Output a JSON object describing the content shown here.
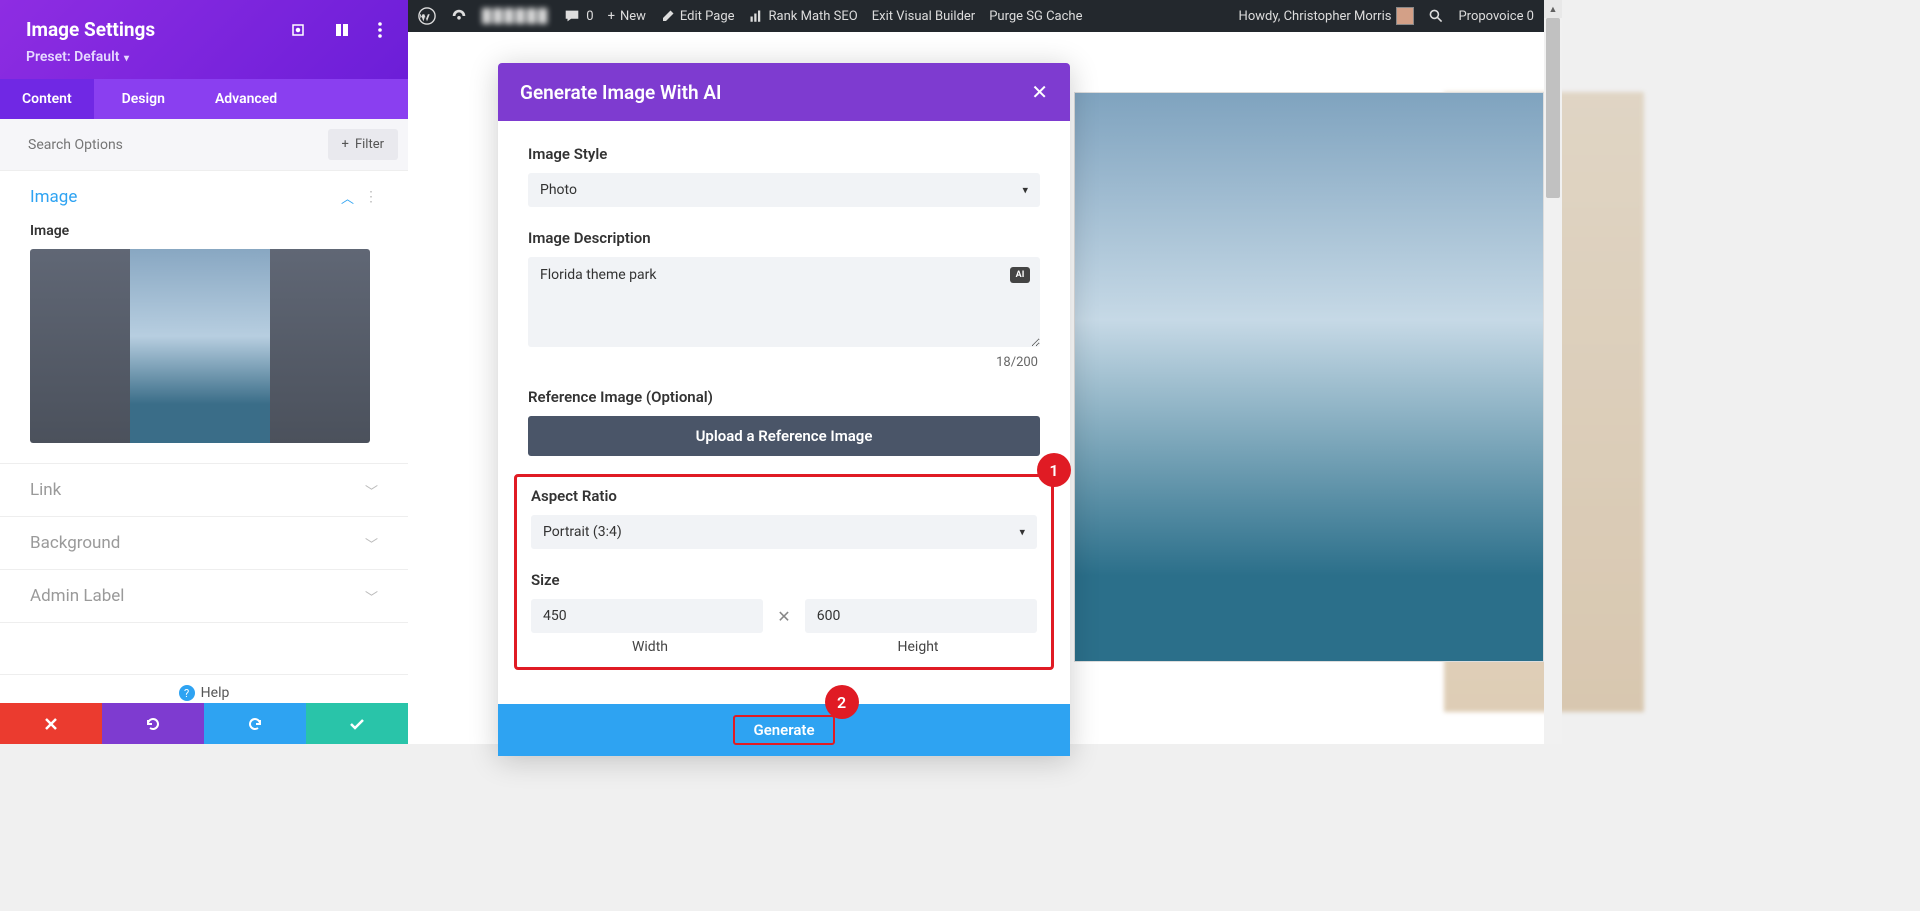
{
  "sidebar": {
    "title": "Image Settings",
    "preset_label": "Preset: Default",
    "tabs": {
      "content": "Content",
      "design": "Design",
      "advanced": "Advanced"
    },
    "search_placeholder": "Search Options",
    "filter_label": "Filter",
    "groups": {
      "image": {
        "title": "Image",
        "field_label": "Image"
      },
      "link": "Link",
      "background": "Background",
      "admin_label": "Admin Label"
    },
    "help_label": "Help"
  },
  "admin_bar": {
    "site_name_masked": "██████",
    "comments_count": "0",
    "new": "New",
    "edit_page": "Edit Page",
    "rank_math": "Rank Math SEO",
    "exit_vb": "Exit Visual Builder",
    "purge_cache": "Purge SG Cache",
    "howdy": "Howdy, Christopher Morris",
    "propovoice": "Propovoice 0"
  },
  "modal": {
    "title": "Generate Image With AI",
    "style_label": "Image Style",
    "style_value": "Photo",
    "desc_label": "Image Description",
    "desc_value": "Florida theme park",
    "ai_badge": "AI",
    "char_count": "18/200",
    "ref_label": "Reference Image (Optional)",
    "upload_label": "Upload a Reference Image",
    "aspect_label": "Aspect Ratio",
    "aspect_value": "Portrait (3:4)",
    "size_label": "Size",
    "width_value": "450",
    "height_value": "600",
    "width_label": "Width",
    "height_label": "Height",
    "generate_label": "Generate",
    "annotation_1": "1",
    "annotation_2": "2"
  }
}
